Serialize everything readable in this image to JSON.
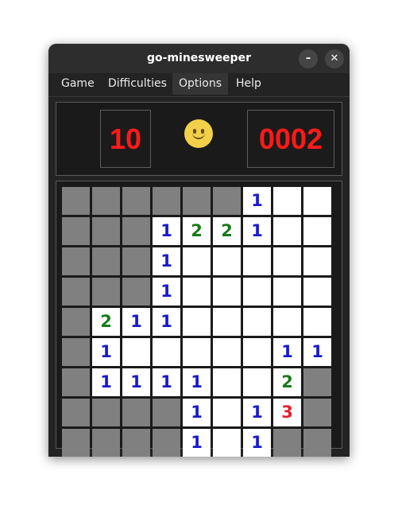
{
  "window": {
    "title": "go-minesweeper",
    "minimize_glyph": "–",
    "close_glyph": "✕"
  },
  "menu": {
    "items": [
      "Game",
      "Difficulties",
      "Options",
      "Help"
    ],
    "active_index": 2
  },
  "hud": {
    "mines_remaining": "10",
    "timer": "0002",
    "face_icon": "smiley-face-icon"
  },
  "number_colors": {
    "1": "#1a1acc",
    "2": "#1a7a1a",
    "3": "#e6202c"
  },
  "board": {
    "rows": 9,
    "cols": 9,
    "legend": {
      "#": "covered",
      ".": "empty open",
      "1-8": "open with number"
    },
    "cells": [
      "######1..",
      "###1221..",
      "###1.....",
      "###1.....",
      "#211.....",
      "#1.....11",
      "#1111..2#",
      "####1.13#",
      "####1.1##"
    ]
  }
}
